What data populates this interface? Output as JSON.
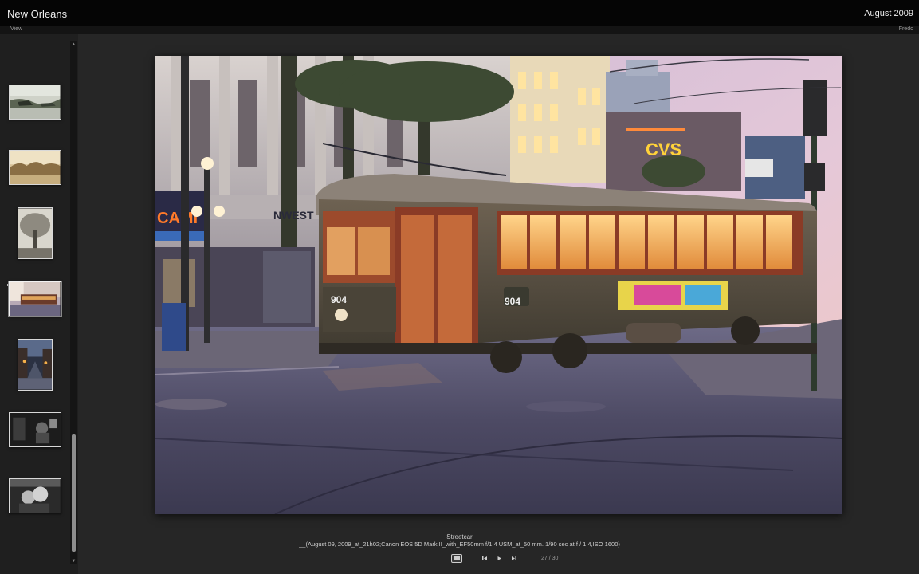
{
  "header": {
    "title": "New Orleans",
    "date": "August 2009"
  },
  "subbar": {
    "view_label": "View",
    "author": "Fredo"
  },
  "filmstrip": {
    "thumbnails": [
      {
        "label": "thumb-1",
        "selected": false
      },
      {
        "label": "thumb-2",
        "selected": false
      },
      {
        "label": "thumb-3",
        "selected": false
      },
      {
        "label": "thumb-4",
        "selected": true
      },
      {
        "label": "thumb-5",
        "selected": false
      },
      {
        "label": "thumb-6",
        "selected": false
      },
      {
        "label": "thumb-7",
        "selected": false
      }
    ]
  },
  "photo": {
    "sign_cvs": "CVS",
    "sign_cami": "CAMI",
    "sign_nwest": "NWEST",
    "car_number": "904",
    "car_number_front": "904"
  },
  "caption": {
    "title": "Streetcar",
    "meta": "__(August 09, 2009_at_21h02;Canon EOS 5D Mark II_with_EF50mm f/1.4 USM_at_50 mm. 1/90 sec at f / 1.4,ISO 1600)"
  },
  "controls": {
    "counter": "27 / 30",
    "icons": [
      "grid-view-icon",
      "previous-icon",
      "play-icon",
      "next-icon"
    ]
  },
  "colors": {
    "background": "#242424",
    "titlebar": "#050505",
    "text": "#e6e6e6"
  }
}
